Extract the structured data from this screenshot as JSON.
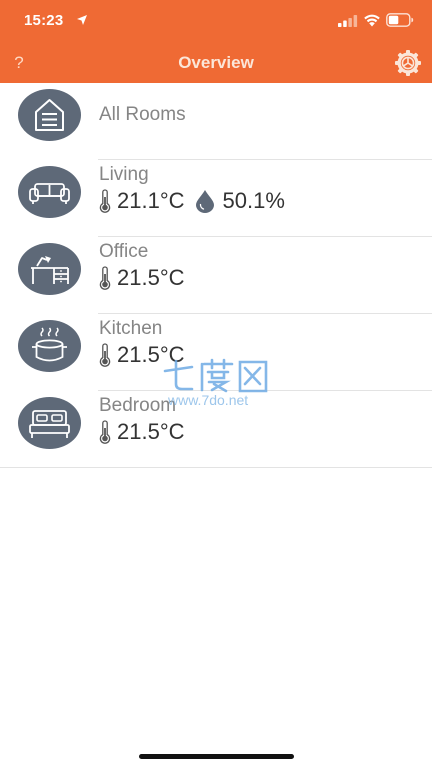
{
  "status_bar": {
    "time": "15:23",
    "icons": [
      "location-arrow-icon",
      "cellular-signal-icon",
      "wifi-icon",
      "battery-icon"
    ]
  },
  "nav": {
    "help_label": "?",
    "title": "Overview",
    "settings_icon": "gear-icon"
  },
  "rooms": [
    {
      "name": "All Rooms",
      "icon": "house-icon"
    },
    {
      "name": "Living",
      "icon": "sofa-icon",
      "temperature": "21.1°C",
      "humidity": "50.1%"
    },
    {
      "name": "Office",
      "icon": "desk-icon",
      "temperature": "21.5°C"
    },
    {
      "name": "Kitchen",
      "icon": "cooking-pot-icon",
      "temperature": "21.5°C"
    },
    {
      "name": "Bedroom",
      "icon": "bed-icon",
      "temperature": "21.5°C"
    }
  ],
  "watermark": {
    "logo": "七度网",
    "url": "www.7do.net"
  },
  "colors": {
    "header": "#EF6A34",
    "room_icon_bg": "#5E6978",
    "room_name": "#858585",
    "reading": "#333333"
  }
}
